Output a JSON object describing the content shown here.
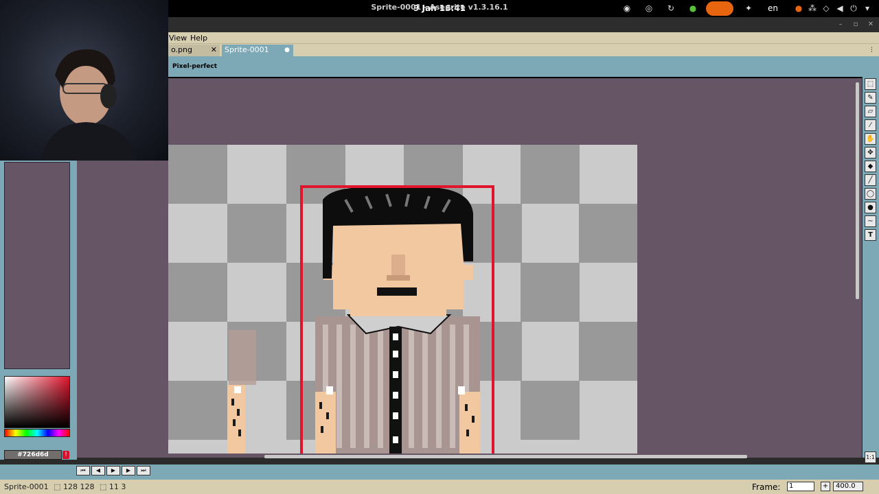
{
  "topbar": {
    "clock": "9 Jan  16:41",
    "language": "en"
  },
  "window": {
    "title": "Sprite-0001 - Aseprite v1.3.16.1"
  },
  "menu": {
    "items": [
      "View",
      "Help"
    ]
  },
  "tabs": [
    {
      "label": "o.png"
    },
    {
      "label": "Sprite-0001"
    }
  ],
  "context_bar": {
    "pixel_perfect": "Pixel-perfect"
  },
  "colors": {
    "foreground_hex": "#726d6d",
    "background_hex": "#cccccc",
    "accent_red": "#d8102b",
    "selection_red": "#e0142c"
  },
  "status": {
    "sprite_name": "Sprite-0001",
    "canvas_size": "128 128",
    "position": "11 3",
    "frame_label": "Frame:",
    "frame_value": "1",
    "zoom_plus": "+",
    "zoom_value": "400.0"
  },
  "tools": [
    "rectangular-marquee",
    "pencil",
    "eraser",
    "eyedropper",
    "hand",
    "move",
    "paint-bucket",
    "line",
    "ellipse",
    "blur",
    "smudge",
    "text"
  ]
}
